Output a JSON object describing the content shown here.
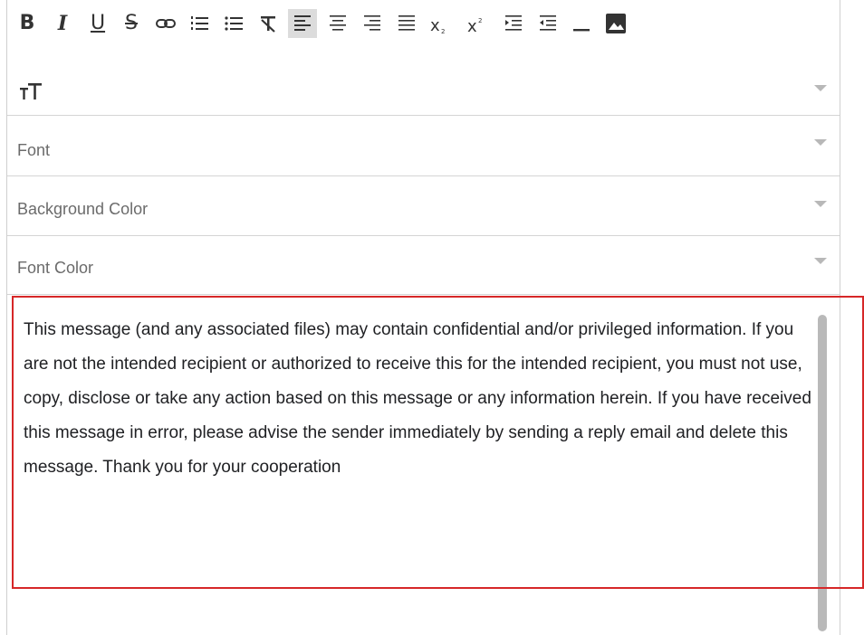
{
  "toolbar": {
    "buttons": [
      {
        "name": "bold",
        "icon": "bold-icon"
      },
      {
        "name": "italic",
        "icon": "italic-icon"
      },
      {
        "name": "underline",
        "icon": "underline-icon"
      },
      {
        "name": "strikethrough",
        "icon": "strikethrough-icon"
      },
      {
        "name": "link",
        "icon": "link-icon"
      },
      {
        "name": "ordered-list",
        "icon": "ordered-list-icon"
      },
      {
        "name": "bullet-list",
        "icon": "bullet-list-icon"
      },
      {
        "name": "clear-format",
        "icon": "clear-format-icon"
      },
      {
        "name": "align-left",
        "icon": "align-left-icon",
        "active": true
      },
      {
        "name": "align-center",
        "icon": "align-center-icon"
      },
      {
        "name": "align-right",
        "icon": "align-right-icon"
      },
      {
        "name": "align-justify",
        "icon": "align-justify-icon"
      },
      {
        "name": "subscript",
        "icon": "subscript-icon"
      },
      {
        "name": "superscript",
        "icon": "superscript-icon"
      },
      {
        "name": "indent",
        "icon": "indent-icon"
      },
      {
        "name": "outdent",
        "icon": "outdent-icon"
      },
      {
        "name": "horizontal-rule",
        "icon": "horizontal-rule-icon"
      },
      {
        "name": "image",
        "icon": "image-icon"
      }
    ],
    "font_size_icon": "text-size-icon"
  },
  "selects": {
    "font": {
      "label": "Font"
    },
    "background_color": {
      "label": "Background Color"
    },
    "font_color": {
      "label": "Font Color"
    }
  },
  "content": {
    "text": "This message (and any associated files) may contain confidential and/or privileged information. If you are not the intended recipient or authorized to receive this for the intended recipient, you must not use, copy, disclose or take any action based on this message or any information herein. If you have received this message in error, please advise the sender immediately by sending a reply email and delete this message. Thank you for your cooperation"
  },
  "colors": {
    "highlight": "#d62728",
    "active_button": "#dcdcdc",
    "icon": "#333333",
    "placeholder": "#6b6b6b"
  }
}
